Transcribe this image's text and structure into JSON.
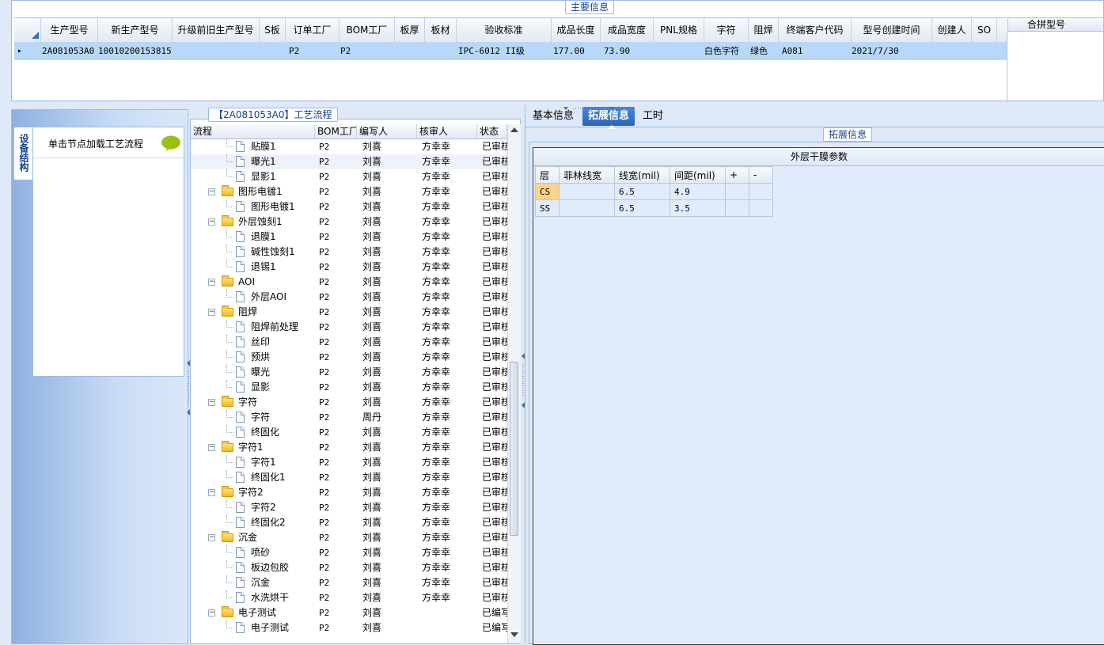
{
  "main_info": {
    "caption": "主要信息",
    "columns": [
      "生产型号",
      "新生产型号",
      "升级前旧生产型号",
      "S板",
      "订单工厂",
      "BOM工厂",
      "板厚",
      "板材",
      "验收标准",
      "成品长度",
      "成品宽度",
      "PNL规格",
      "字符",
      "阻焊",
      "终端客户代码",
      "型号创建时间",
      "创建人",
      "SO"
    ],
    "row": {
      "marker": "▸",
      "production_model": "2A081053A0",
      "new_production_model": "10010200153815",
      "old_model": "",
      "s_board": "",
      "order_factory": "P2",
      "bom_factory": "P2",
      "thickness": "",
      "material": "",
      "standard": "IPC-6012 II级",
      "length": "177.00",
      "width": "73.90",
      "pnl": "",
      "char": "白色字符",
      "solder_mask": "绿色",
      "customer_code": "A081",
      "create_time": "2021/7/30",
      "creator": "",
      "so": ""
    },
    "merge_header": "合拼型号"
  },
  "left_panel": {
    "vertical_tab": "设备结构",
    "node_hint": "单击节点加载工艺流程"
  },
  "process": {
    "caption": "【2A081053A0】工艺流程",
    "headers": [
      "流程",
      "BOM工厂",
      "编写人",
      "核审人",
      "状态"
    ],
    "rows": [
      {
        "name": "贴膜1",
        "type": "doc",
        "level": 2,
        "bom": "P2",
        "writer": "刘喜",
        "reviewer": "方幸幸",
        "status": "已审核"
      },
      {
        "name": "曝光1",
        "type": "doc",
        "level": 2,
        "bom": "P2",
        "writer": "刘喜",
        "reviewer": "方幸幸",
        "status": "已审核",
        "selected": true
      },
      {
        "name": "显影1",
        "type": "doc",
        "level": 2,
        "bom": "P2",
        "writer": "刘喜",
        "reviewer": "方幸幸",
        "status": "已审核"
      },
      {
        "name": "图形电镀1",
        "type": "folder",
        "level": 1,
        "bom": "P2",
        "writer": "刘喜",
        "reviewer": "方幸幸",
        "status": "已审核"
      },
      {
        "name": "图形电镀1",
        "type": "doc",
        "level": 2,
        "bom": "P2",
        "writer": "刘喜",
        "reviewer": "方幸幸",
        "status": "已审核"
      },
      {
        "name": "外层蚀刻1",
        "type": "folder",
        "level": 1,
        "bom": "P2",
        "writer": "刘喜",
        "reviewer": "方幸幸",
        "status": "已审核"
      },
      {
        "name": "退膜1",
        "type": "doc",
        "level": 2,
        "bom": "P2",
        "writer": "刘喜",
        "reviewer": "方幸幸",
        "status": "已审核"
      },
      {
        "name": "碱性蚀刻1",
        "type": "doc",
        "level": 2,
        "bom": "P2",
        "writer": "刘喜",
        "reviewer": "方幸幸",
        "status": "已审核"
      },
      {
        "name": "退锡1",
        "type": "doc",
        "level": 2,
        "bom": "P2",
        "writer": "刘喜",
        "reviewer": "方幸幸",
        "status": "已审核"
      },
      {
        "name": "AOI",
        "type": "folder",
        "level": 1,
        "bom": "P2",
        "writer": "刘喜",
        "reviewer": "方幸幸",
        "status": "已审核"
      },
      {
        "name": "外层AOI",
        "type": "doc",
        "level": 2,
        "bom": "P2",
        "writer": "刘喜",
        "reviewer": "方幸幸",
        "status": "已审核"
      },
      {
        "name": "阻焊",
        "type": "folder",
        "level": 1,
        "bom": "P2",
        "writer": "刘喜",
        "reviewer": "方幸幸",
        "status": "已审核"
      },
      {
        "name": "阻焊前处理",
        "type": "doc",
        "level": 2,
        "bom": "P2",
        "writer": "刘喜",
        "reviewer": "方幸幸",
        "status": "已审核"
      },
      {
        "name": "丝印",
        "type": "doc",
        "level": 2,
        "bom": "P2",
        "writer": "刘喜",
        "reviewer": "方幸幸",
        "status": "已审核"
      },
      {
        "name": "预烘",
        "type": "doc",
        "level": 2,
        "bom": "P2",
        "writer": "刘喜",
        "reviewer": "方幸幸",
        "status": "已审核"
      },
      {
        "name": "曝光",
        "type": "doc",
        "level": 2,
        "bom": "P2",
        "writer": "刘喜",
        "reviewer": "方幸幸",
        "status": "已审核"
      },
      {
        "name": "显影",
        "type": "doc",
        "level": 2,
        "bom": "P2",
        "writer": "刘喜",
        "reviewer": "方幸幸",
        "status": "已审核"
      },
      {
        "name": "字符",
        "type": "folder",
        "level": 1,
        "bom": "P2",
        "writer": "刘喜",
        "reviewer": "方幸幸",
        "status": "已审核"
      },
      {
        "name": "字符",
        "type": "doc",
        "level": 2,
        "bom": "P2",
        "writer": "周丹",
        "reviewer": "方幸幸",
        "status": "已审核"
      },
      {
        "name": "终固化",
        "type": "doc",
        "level": 2,
        "bom": "P2",
        "writer": "刘喜",
        "reviewer": "方幸幸",
        "status": "已审核"
      },
      {
        "name": "字符1",
        "type": "folder",
        "level": 1,
        "bom": "P2",
        "writer": "刘喜",
        "reviewer": "方幸幸",
        "status": "已审核"
      },
      {
        "name": "字符1",
        "type": "doc",
        "level": 2,
        "bom": "P2",
        "writer": "刘喜",
        "reviewer": "方幸幸",
        "status": "已审核"
      },
      {
        "name": "终固化1",
        "type": "doc",
        "level": 2,
        "bom": "P2",
        "writer": "刘喜",
        "reviewer": "方幸幸",
        "status": "已审核"
      },
      {
        "name": "字符2",
        "type": "folder",
        "level": 1,
        "bom": "P2",
        "writer": "刘喜",
        "reviewer": "方幸幸",
        "status": "已审核"
      },
      {
        "name": "字符2",
        "type": "doc",
        "level": 2,
        "bom": "P2",
        "writer": "刘喜",
        "reviewer": "方幸幸",
        "status": "已审核"
      },
      {
        "name": "终固化2",
        "type": "doc",
        "level": 2,
        "bom": "P2",
        "writer": "刘喜",
        "reviewer": "方幸幸",
        "status": "已审核"
      },
      {
        "name": "沉金",
        "type": "folder",
        "level": 1,
        "bom": "P2",
        "writer": "刘喜",
        "reviewer": "方幸幸",
        "status": "已审核"
      },
      {
        "name": "喷砂",
        "type": "doc",
        "level": 2,
        "bom": "P2",
        "writer": "刘喜",
        "reviewer": "方幸幸",
        "status": "已审核"
      },
      {
        "name": "板边包胶",
        "type": "doc",
        "level": 2,
        "bom": "P2",
        "writer": "刘喜",
        "reviewer": "方幸幸",
        "status": "已审核"
      },
      {
        "name": "沉金",
        "type": "doc",
        "level": 2,
        "bom": "P2",
        "writer": "刘喜",
        "reviewer": "方幸幸",
        "status": "已审核"
      },
      {
        "name": "水洗烘干",
        "type": "doc",
        "level": 2,
        "bom": "P2",
        "writer": "刘喜",
        "reviewer": "方幸幸",
        "status": "已审核"
      },
      {
        "name": "电子测试",
        "type": "folder",
        "level": 1,
        "bom": "P2",
        "writer": "刘喜",
        "reviewer": "",
        "status": "已编写"
      },
      {
        "name": "电子测试",
        "type": "doc",
        "level": 2,
        "bom": "P2",
        "writer": "刘喜",
        "reviewer": "",
        "status": "已编写"
      }
    ]
  },
  "right_panel": {
    "tabs": [
      {
        "label": "基本信息",
        "active": false
      },
      {
        "label": "拓展信息",
        "active": true
      },
      {
        "label": "工时",
        "active": false
      }
    ],
    "ext_caption": "拓展信息",
    "dry_film_title": "外层干膜参数",
    "dry_film_headers": [
      "层",
      "菲林线宽",
      "线宽(mil)",
      "间距(mil)",
      "+",
      "-"
    ],
    "dry_film_rows": [
      {
        "layer": "CS",
        "film_width": "",
        "line_width": "6.5",
        "spacing": "4.9"
      },
      {
        "layer": "SS",
        "film_width": "",
        "line_width": "6.5",
        "spacing": "3.5"
      }
    ]
  },
  "colors": {
    "selection_blue": "#b9d8f8",
    "active_tab": "#2b64b8",
    "layer_highlight": "#fbd48a",
    "frame_border": "#99bbe8",
    "speech_icon": "#9ac010"
  },
  "icons": [
    "speech-bubble-icon",
    "folder-icon",
    "document-icon",
    "row-marker-icon",
    "sort-corner-icon"
  ]
}
